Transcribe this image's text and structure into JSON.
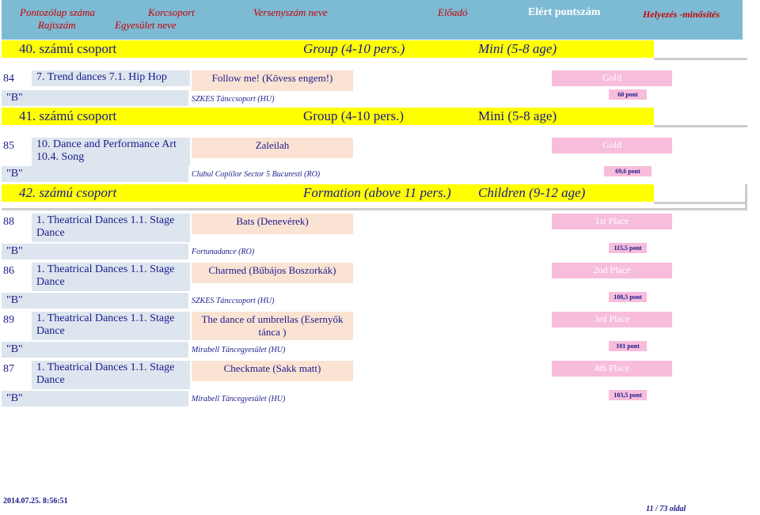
{
  "header": {
    "col1_line1": "Pontozólap száma",
    "col1_line2": "Rajtszám",
    "col2_line1": "Korcsoport",
    "col2_line2": "Egyesület neve",
    "col3": "Versenyszám neve",
    "col4": "Előadó",
    "col5": "Elért pontszám",
    "col6": "Helyezés -minősítés"
  },
  "groups": [
    {
      "label": "40. számú csoport",
      "type": "Group (4-10 pers.)",
      "age": "Mini (5-8 age)"
    },
    {
      "label": "41. számú csoport",
      "type": "Group (4-10 pers.)",
      "age": "Mini (5-8 age)"
    },
    {
      "label": "42. számú csoport",
      "type": "Formation (above 11 pers.)",
      "age": "Children (9-12 age)"
    }
  ],
  "entries": [
    {
      "num": "84",
      "cat1": "7. Trend dances 7.1. Hip Hop",
      "cat2": "",
      "title": "Follow me! (Kövess engem!)",
      "club": "SZKES Tánccsoport (HU)",
      "rank": "\"B\"",
      "place": "Gold",
      "points": "60 pont"
    },
    {
      "num": "85",
      "cat1": "10. Dance and Performance Art",
      "cat2": "10.4. Song",
      "title": "Zaleilah",
      "club": "Clubul Copiilor Sector 5 Bucuresti (RO)",
      "rank": "\"B\"",
      "place": "Gold",
      "points": "69,6 pont"
    },
    {
      "num": "88",
      "cat1": "1. Theatrical Dances 1.1. Stage",
      "cat2": "Dance",
      "title": "Bats (Denevérek)",
      "club": "Fortunadance (RO)",
      "rank": "\"B\"",
      "place": "1st Place",
      "points": "115,5 pont"
    },
    {
      "num": "86",
      "cat1": "1. Theatrical Dances 1.1. Stage",
      "cat2": "Dance",
      "title": "Charmed (Bűbájos Boszorkák)",
      "club": "SZKES Tánccsoport (HU)",
      "rank": "\"B\"",
      "place": "2nd Place",
      "points": "108,5 pont"
    },
    {
      "num": "89",
      "cat1": "1. Theatrical Dances 1.1. Stage",
      "cat2": "Dance",
      "title": "The dance of umbrellas (Esernyők tánca )",
      "club": "Mirabell Táncegyesület (HU)",
      "rank": "\"B\"",
      "place": "3rd Place",
      "points": "101 pont"
    },
    {
      "num": "87",
      "cat1": "1. Theatrical Dances 1.1. Stage",
      "cat2": "Dance",
      "title": "Checkmate (Sakk matt)",
      "club": "Mirabell Táncegyesület (HU)",
      "rank": "\"B\"",
      "place": "4th Place",
      "points": "103,5 pont"
    }
  ],
  "footer": {
    "timestamp": "2014.07.25. 8:56:51",
    "page": "11 / 73 oldal"
  },
  "colors": {
    "header_bg": "#7dbad4",
    "group_bar": "#ffff00",
    "category_bg": "#dde5ee",
    "title_bg": "#fbe3d3",
    "place_bg": "#f7bddb",
    "text": "#1a1a8c",
    "header_text": "#c80000"
  }
}
